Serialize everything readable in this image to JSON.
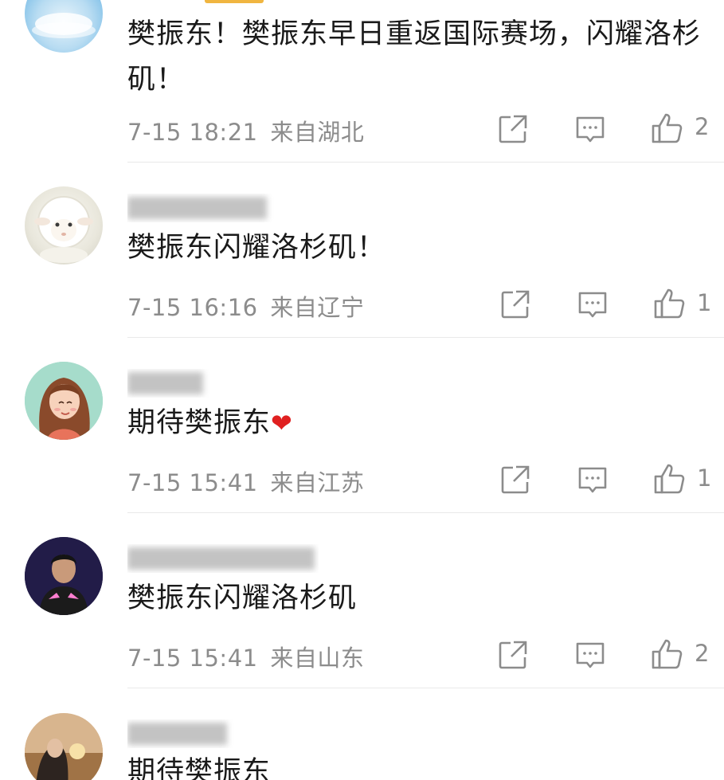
{
  "comments": [
    {
      "text": "樊振东！樊振东早日重返国际赛场，闪耀洛杉矶！",
      "time": "7-15 18:21",
      "location": "来自湖北",
      "likes": "2",
      "username_visible": false,
      "avatar": "cloud-avatar"
    },
    {
      "text": "樊振东闪耀洛杉矶！",
      "time": "7-15 16:16",
      "location": "来自辽宁",
      "likes": "1",
      "username_visible": false,
      "avatar": "sheep-avatar"
    },
    {
      "text": "期待樊振东",
      "emoji": "❤",
      "time": "7-15 15:41",
      "location": "来自江苏",
      "likes": "1",
      "username_visible": false,
      "avatar": "girl-illustration-avatar"
    },
    {
      "text": "樊振东闪耀洛杉矶",
      "time": "7-15 15:41",
      "location": "来自山东",
      "likes": "2",
      "username_visible": false,
      "avatar": "player-photo-avatar"
    },
    {
      "text": "期待樊振东",
      "username_visible": false,
      "avatar": "sunset-photo-avatar"
    }
  ],
  "icons": {
    "share": "share-icon",
    "reply": "comment-icon",
    "like": "thumbs-up-icon"
  },
  "colors": {
    "meta_text": "#8c8c8c",
    "body_text": "#1a1a1a",
    "heart": "#e02020",
    "divider": "#e9e9e9"
  }
}
